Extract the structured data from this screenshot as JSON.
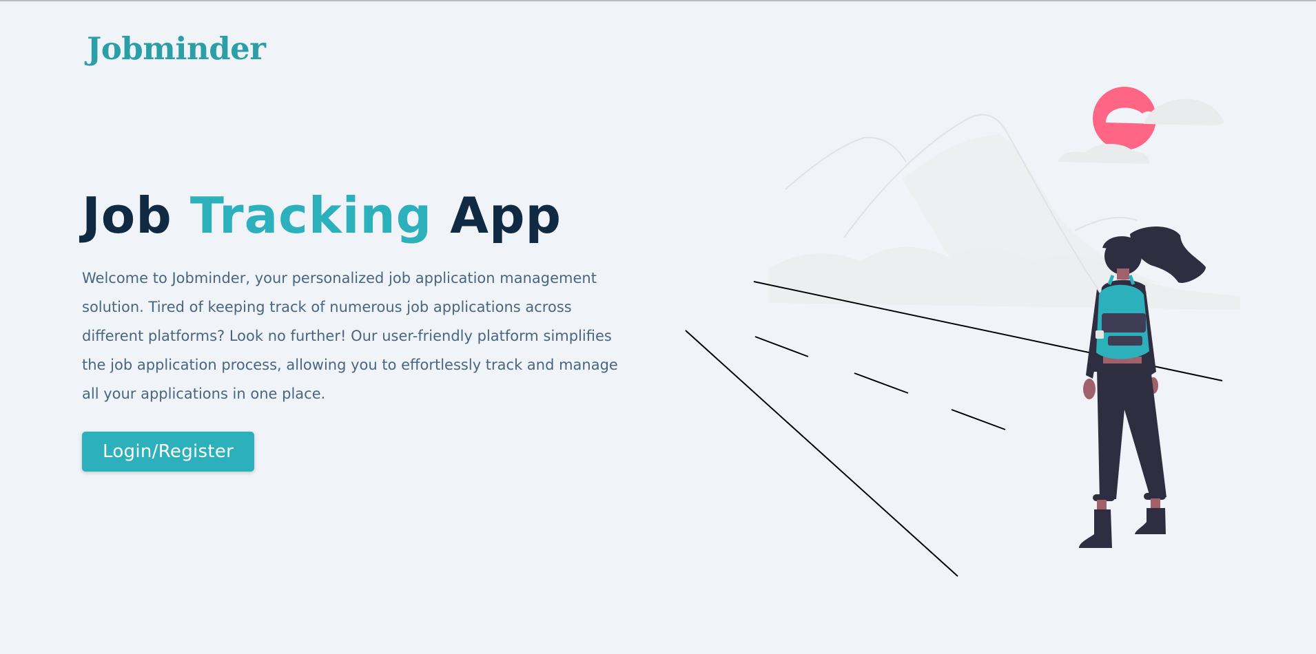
{
  "brand": {
    "logo": "Jobminder",
    "primary_color": "#2cb1bc",
    "logo_color": "#2c9ea5",
    "heading_color": "#102a43",
    "text_color": "#486581"
  },
  "hero": {
    "title_part1": "Job",
    "title_accent": "Tracking",
    "title_part2": "App",
    "description": "Welcome to Jobminder, your personalized job application management solution. Tired of keeping track of numerous job applications across different platforms? Look no further! Our user-friendly platform simplifies the job application process, allowing you to effortlessly track and manage all your applications in one place.",
    "cta_label": "Login/Register"
  },
  "illustration": {
    "subject": "woman-with-backpack-on-road",
    "sun_color": "#ff6584",
    "backpack_color": "#2cb1bc"
  }
}
